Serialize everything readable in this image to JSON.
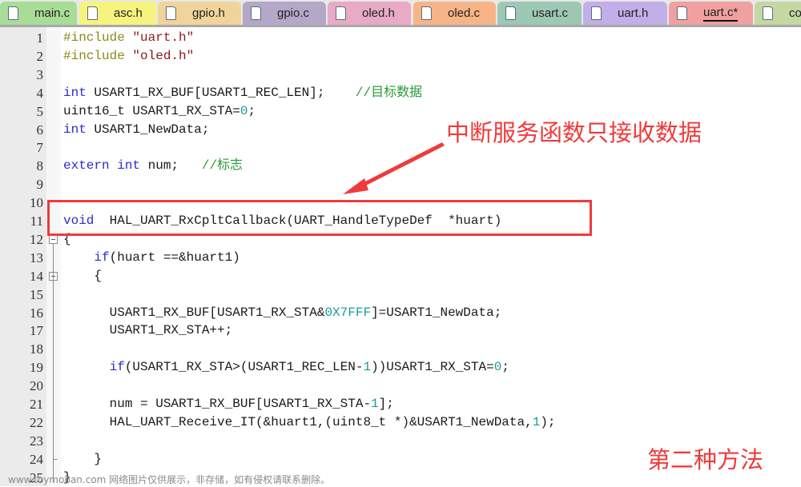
{
  "tabs": [
    {
      "label": "main.c",
      "color": "#a8dd98",
      "active": false
    },
    {
      "label": "asc.h",
      "color": "#f6f47e",
      "active": false
    },
    {
      "label": "gpio.h",
      "color": "#f0d49a",
      "active": false
    },
    {
      "label": "gpio.c",
      "color": "#b4a8c8",
      "active": false
    },
    {
      "label": "oled.h",
      "color": "#e8aac4",
      "active": false
    },
    {
      "label": "oled.c",
      "color": "#f7b486",
      "active": false
    },
    {
      "label": "usart.c",
      "color": "#9cc8b4",
      "active": false
    },
    {
      "label": "uart.h",
      "color": "#c2aee8",
      "active": false
    },
    {
      "label": "uart.c*",
      "color": "#f0a0a0",
      "active": true
    },
    {
      "label": "co",
      "color": "#c4d8a4",
      "active": false
    }
  ],
  "code_lines": [
    {
      "n": "1",
      "html": "<span class=\"pp\">#include</span> <span class=\"str\">\"uart.h\"</span>"
    },
    {
      "n": "2",
      "html": "<span class=\"pp\">#include</span> <span class=\"str\">\"oled.h\"</span>"
    },
    {
      "n": "3",
      "html": ""
    },
    {
      "n": "4",
      "html": "<span class=\"kw\">int</span> USART1_RX_BUF[USART1_REC_LEN];    <span class=\"cm\">//目标数据</span>"
    },
    {
      "n": "5",
      "html": "uint16_t USART1_RX_STA=<span class=\"num\">0</span>;"
    },
    {
      "n": "6",
      "html": "<span class=\"kw\">int</span> USART1_NewData;"
    },
    {
      "n": "7",
      "html": ""
    },
    {
      "n": "8",
      "html": "<span class=\"kw\">extern</span> <span class=\"kw\">int</span> num;   <span class=\"cm\">//标志</span>"
    },
    {
      "n": "9",
      "html": ""
    },
    {
      "n": "10",
      "html": ""
    },
    {
      "n": "11",
      "html": "<span class=\"kw\">void</span>  HAL_UART_RxCpltCallback(UART_HandleTypeDef  *huart)"
    },
    {
      "n": "12",
      "html": "{"
    },
    {
      "n": "13",
      "html": "    <span class=\"kw\">if</span>(huart ==&amp;huart1)"
    },
    {
      "n": "14",
      "html": "    {"
    },
    {
      "n": "15",
      "html": ""
    },
    {
      "n": "16",
      "html": "      USART1_RX_BUF[USART1_RX_STA&amp;<span class=\"num\">0X7FFF</span>]=USART1_NewData;"
    },
    {
      "n": "17",
      "html": "      USART1_RX_STA++;"
    },
    {
      "n": "18",
      "html": ""
    },
    {
      "n": "19",
      "html": "      <span class=\"kw\">if</span>(USART1_RX_STA&gt;(USART1_REC_LEN-<span class=\"num\">1</span>))USART1_RX_STA=<span class=\"num\">0</span>;"
    },
    {
      "n": "20",
      "html": ""
    },
    {
      "n": "21",
      "html": "      num = USART1_RX_BUF[USART1_RX_STA-<span class=\"num\">1</span>];"
    },
    {
      "n": "22",
      "html": "      HAL_UART_Receive_IT(&amp;huart1,(uint8_t *)&amp;USART1_NewData,<span class=\"num\">1</span>);"
    },
    {
      "n": "23",
      "html": ""
    },
    {
      "n": "24",
      "html": "    }"
    },
    {
      "n": "25",
      "html": "}"
    }
  ],
  "annotations": {
    "callout": "中断服务函数只接收数据",
    "method": "第二种方法",
    "accent_color": "#f03a3a"
  },
  "watermark": "www.toymoban.com 网络图片仅供展示，非存储，如有侵权请联系删除。"
}
